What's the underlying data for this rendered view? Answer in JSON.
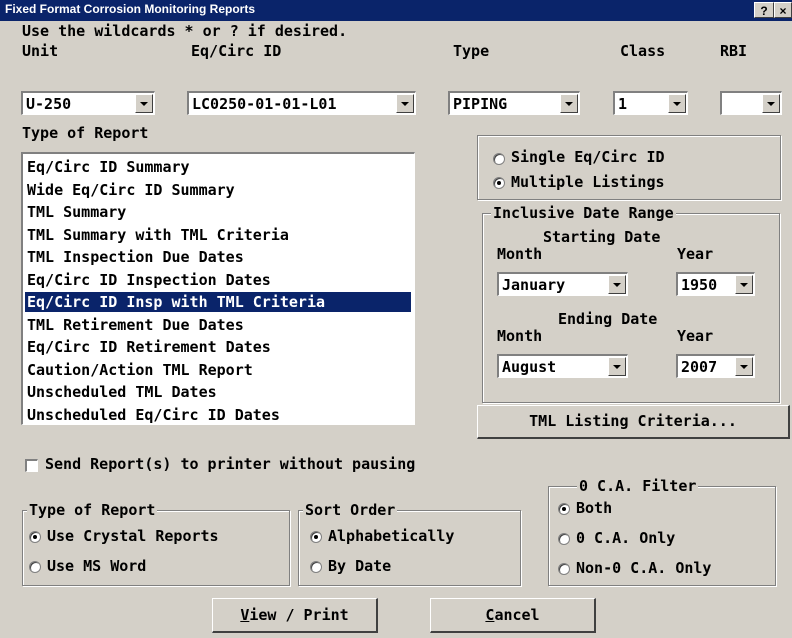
{
  "window": {
    "title": "Fixed Format Corrosion Monitoring Reports",
    "help_glyph": "?",
    "close_glyph": "×"
  },
  "hint": "Use the wildcards * or ? if desired.",
  "labels": {
    "unit": "Unit",
    "eqcirc": "Eq/Circ ID",
    "type": "Type",
    "class": "Class",
    "rbi": "RBI",
    "type_of_report": "Type of Report"
  },
  "fields": {
    "unit": "U-250",
    "eqcirc": "LC0250-01-01-L01",
    "type": "PIPING",
    "class": "1",
    "rbi": ""
  },
  "report_list": {
    "items": [
      "Eq/Circ ID Summary",
      "Wide Eq/Circ ID Summary",
      "TML Summary",
      "TML Summary with TML Criteria",
      "TML Inspection Due Dates",
      "Eq/Circ ID Inspection Dates",
      "Eq/Circ ID Insp with TML Criteria",
      "TML Retirement Due Dates",
      "Eq/Circ ID Retirement Dates",
      "Caution/Action TML Report",
      "Unscheduled TML Dates",
      "Unscheduled Eq/Circ ID Dates"
    ],
    "selected_index": 6
  },
  "listing_mode": {
    "single": "Single Eq/Circ ID",
    "multiple": "Multiple Listings",
    "selected": "multiple"
  },
  "date_range": {
    "title": "Inclusive Date Range",
    "starting_title": "Starting Date",
    "ending_title": "Ending Date",
    "month_label": "Month",
    "year_label": "Year",
    "start_month": "January",
    "start_year": "1950",
    "end_month": "August",
    "end_year": "2007"
  },
  "tml_button": "TML Listing Criteria...",
  "send_printer": {
    "label": "Send Report(s) to printer without pausing",
    "checked": false
  },
  "report_type_group": {
    "title": "Type of Report",
    "crystal": "Use Crystal Reports",
    "word": "Use MS Word",
    "selected": "crystal"
  },
  "sort_group": {
    "title": "Sort Order",
    "alpha": "Alphabetically",
    "date": "By Date",
    "selected": "alpha"
  },
  "ca_filter": {
    "title": "0 C.A. Filter",
    "both": "Both",
    "only": "0 C.A. Only",
    "non": "Non-0 C.A. Only",
    "selected": "both"
  },
  "buttons": {
    "view_print_mn": "V",
    "view_print_rest": "iew / Print",
    "cancel_mn": "C",
    "cancel_rest": "ancel"
  }
}
